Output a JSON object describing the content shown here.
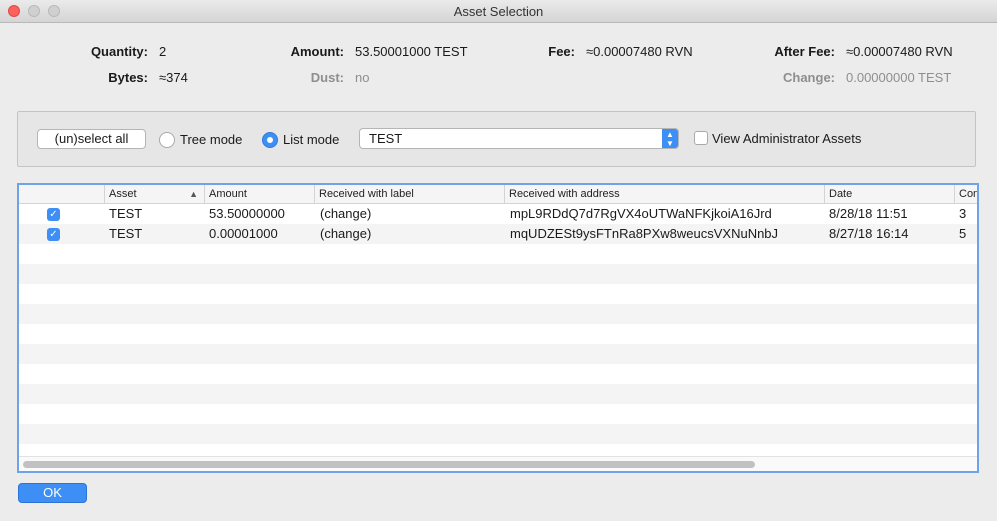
{
  "window": {
    "title": "Asset Selection"
  },
  "stats": {
    "quantity_label": "Quantity:",
    "quantity_value": "2",
    "amount_label": "Amount:",
    "amount_value": "53.50001000 TEST",
    "fee_label": "Fee:",
    "fee_value": "≈0.00007480 RVN",
    "after_fee_label": "After Fee:",
    "after_fee_value": "≈0.00007480 RVN",
    "bytes_label": "Bytes:",
    "bytes_value": "≈374",
    "dust_label": "Dust:",
    "dust_value": "no",
    "change_label": "Change:",
    "change_value": "0.00000000 TEST"
  },
  "filters": {
    "unselect_all": "(un)select all",
    "tree_mode": "Tree mode",
    "list_mode": "List mode",
    "selected_mode": "list",
    "asset_select_value": "TEST",
    "view_admin_label": "View Administrator Assets",
    "view_admin_checked": false
  },
  "table": {
    "columns": [
      "Asset",
      "Amount",
      "Received with label",
      "Received with address",
      "Date",
      "Con"
    ],
    "rows": [
      {
        "checked": true,
        "asset": "TEST",
        "amount": "53.50000000",
        "label": "(change)",
        "address": "mpL9RDdQ7d7RgVX4oUTWaNFKjkoiA16Jrd",
        "date": "8/28/18 11:51",
        "conf": "3"
      },
      {
        "checked": true,
        "asset": "TEST",
        "amount": "0.00001000",
        "label": "(change)",
        "address": "mqUDZESt9ysFTnRa8PXw8weucsVXNuNnbJ",
        "date": "8/27/18 16:14",
        "conf": "5"
      }
    ]
  },
  "footer": {
    "ok_label": "OK"
  },
  "colors": {
    "accent": "#3d8ef5",
    "close": "#fc615d"
  }
}
